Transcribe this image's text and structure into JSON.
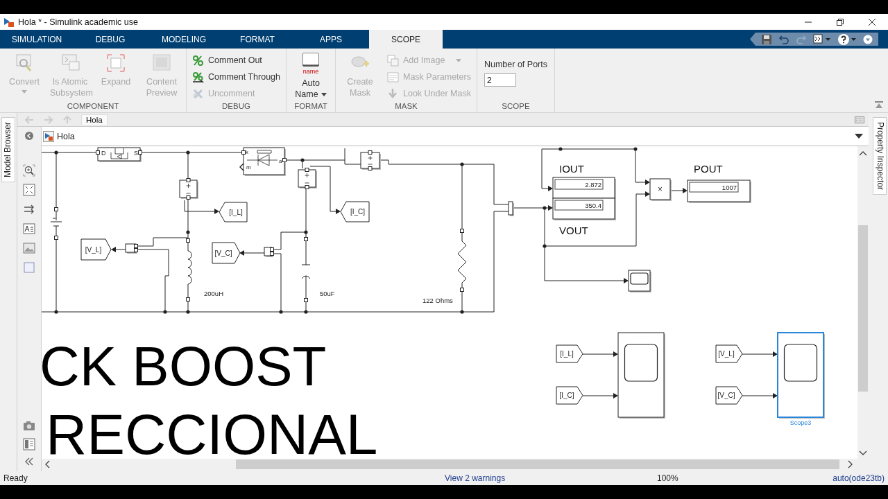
{
  "window": {
    "title": "Hola * - Simulink academic use"
  },
  "tabs": [
    {
      "label": "SIMULATION",
      "selected": false
    },
    {
      "label": "DEBUG",
      "selected": false
    },
    {
      "label": "MODELING",
      "selected": false
    },
    {
      "label": "FORMAT",
      "selected": false
    },
    {
      "label": "APPS",
      "selected": false
    },
    {
      "label": "SCOPE",
      "selected": true
    }
  ],
  "ribbon": {
    "sections": [
      {
        "title": "COMPONENT",
        "items": [
          {
            "kind": "large",
            "label": "Convert",
            "dropdown": true,
            "disabled": true
          },
          {
            "kind": "large",
            "label": "Is Atomic Subsystem",
            "dropdown": false,
            "disabled": true
          },
          {
            "kind": "large",
            "label": "Expand",
            "dropdown": false,
            "disabled": true
          },
          {
            "kind": "large",
            "label": "Content Preview",
            "dropdown": false,
            "disabled": true
          }
        ]
      },
      {
        "title": "DEBUG",
        "items": [
          {
            "kind": "small",
            "label": "Comment Out",
            "dropdown": false,
            "disabled": false
          },
          {
            "kind": "small",
            "label": "Comment Through",
            "dropdown": false,
            "disabled": false
          },
          {
            "kind": "small",
            "label": "Uncomment",
            "dropdown": false,
            "disabled": true
          }
        ]
      },
      {
        "title": "FORMAT",
        "items": [
          {
            "kind": "large",
            "label": "Auto Name",
            "badge": "name",
            "dropdown": true,
            "disabled": false
          }
        ]
      },
      {
        "title": "MASK",
        "items": [
          {
            "kind": "large",
            "label": "Create Mask",
            "dropdown": false,
            "disabled": true
          },
          {
            "kind": "small",
            "label": "Add Image",
            "dropdown": true,
            "disabled": true
          },
          {
            "kind": "small",
            "label": "Mask Parameters",
            "dropdown": false,
            "disabled": true
          },
          {
            "kind": "small",
            "label": "Look Under Mask",
            "dropdown": false,
            "disabled": true
          }
        ]
      },
      {
        "title": "SCOPE",
        "items": [
          {
            "kind": "field",
            "label": "Number of Ports",
            "value": "2"
          }
        ]
      }
    ]
  },
  "side_tabs": {
    "left": "Model Browser",
    "right": "Property Inspector"
  },
  "breadcrumb": {
    "tab": "Hola"
  },
  "address": "Hola",
  "diagram": {
    "mosfet_ports": [
      "D",
      "S"
    ],
    "diode_ports": [
      "k",
      "a",
      "m"
    ],
    "goto_tags": [
      {
        "label": "[I_L]"
      },
      {
        "label": "[I_C]"
      },
      {
        "label": "[V_L]"
      },
      {
        "label": "[V_C]"
      }
    ],
    "parameters": [
      {
        "label": "200uH"
      },
      {
        "label": "50uF"
      },
      {
        "label": "122 Ohms"
      }
    ],
    "displays": [
      {
        "title": "IOUT",
        "value": "2.872"
      },
      {
        "title": "VOUT",
        "value": "350.4"
      },
      {
        "title": "POUT",
        "value": "1007"
      }
    ],
    "product": {
      "symbol": "×"
    },
    "from_tags": [
      {
        "label": "[I_L]"
      },
      {
        "label": "[I_C]"
      },
      {
        "label": "[V_L]"
      },
      {
        "label": "[V_C]"
      }
    ],
    "scopes": [
      {
        "selected": false
      },
      {
        "selected": false
      },
      {
        "selected": true,
        "name": "Scope3"
      }
    ],
    "annotation": [
      "CK BOOST",
      "RECCIONAL"
    ]
  },
  "status_bar": {
    "left": "Ready",
    "warnings": "View 2 warnings",
    "zoom": "100%",
    "solver": "auto(ode23tb)"
  }
}
